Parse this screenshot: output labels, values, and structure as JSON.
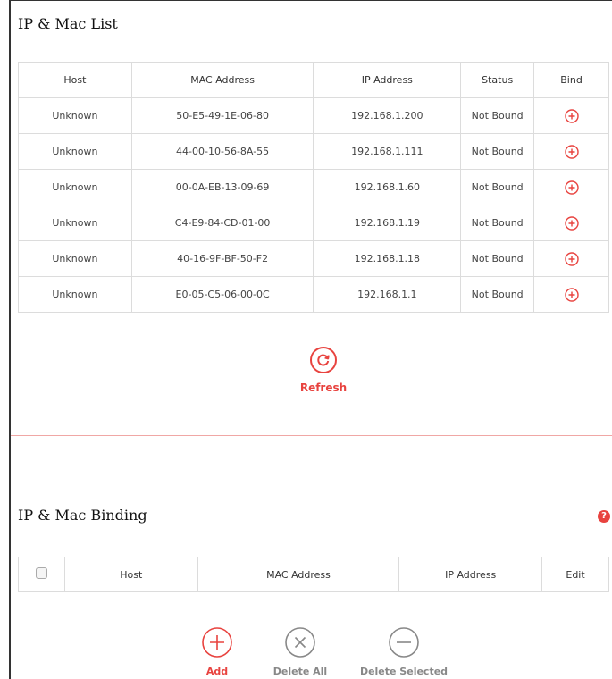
{
  "list_section": {
    "title": "IP & Mac List",
    "columns": [
      "Host",
      "MAC Address",
      "IP Address",
      "Status",
      "Bind"
    ],
    "rows": [
      {
        "host": "Unknown",
        "mac": "50-E5-49-1E-06-80",
        "ip": "192.168.1.200",
        "status": "Not Bound"
      },
      {
        "host": "Unknown",
        "mac": "44-00-10-56-8A-55",
        "ip": "192.168.1.111",
        "status": "Not Bound"
      },
      {
        "host": "Unknown",
        "mac": "00-0A-EB-13-09-69",
        "ip": "192.168.1.60",
        "status": "Not Bound"
      },
      {
        "host": "Unknown",
        "mac": "C4-E9-84-CD-01-00",
        "ip": "192.168.1.19",
        "status": "Not Bound"
      },
      {
        "host": "Unknown",
        "mac": "40-16-9F-BF-50-F2",
        "ip": "192.168.1.18",
        "status": "Not Bound"
      },
      {
        "host": "Unknown",
        "mac": "E0-05-C5-06-00-0C",
        "ip": "192.168.1.1",
        "status": "Not Bound"
      }
    ],
    "bind_icon": "plus-circle-icon",
    "refresh_label": "Refresh",
    "refresh_icon": "refresh-icon"
  },
  "binding_section": {
    "title": "IP & Mac Binding",
    "help_icon": "help-icon",
    "help_symbol": "?",
    "columns": [
      "Host",
      "MAC Address",
      "IP Address",
      "Edit"
    ],
    "actions": {
      "add": "Add",
      "delete_all": "Delete All",
      "delete_selected": "Delete Selected"
    }
  },
  "colors": {
    "accent": "#e8433f",
    "border": "#dcdcdc",
    "muted": "#888888"
  }
}
